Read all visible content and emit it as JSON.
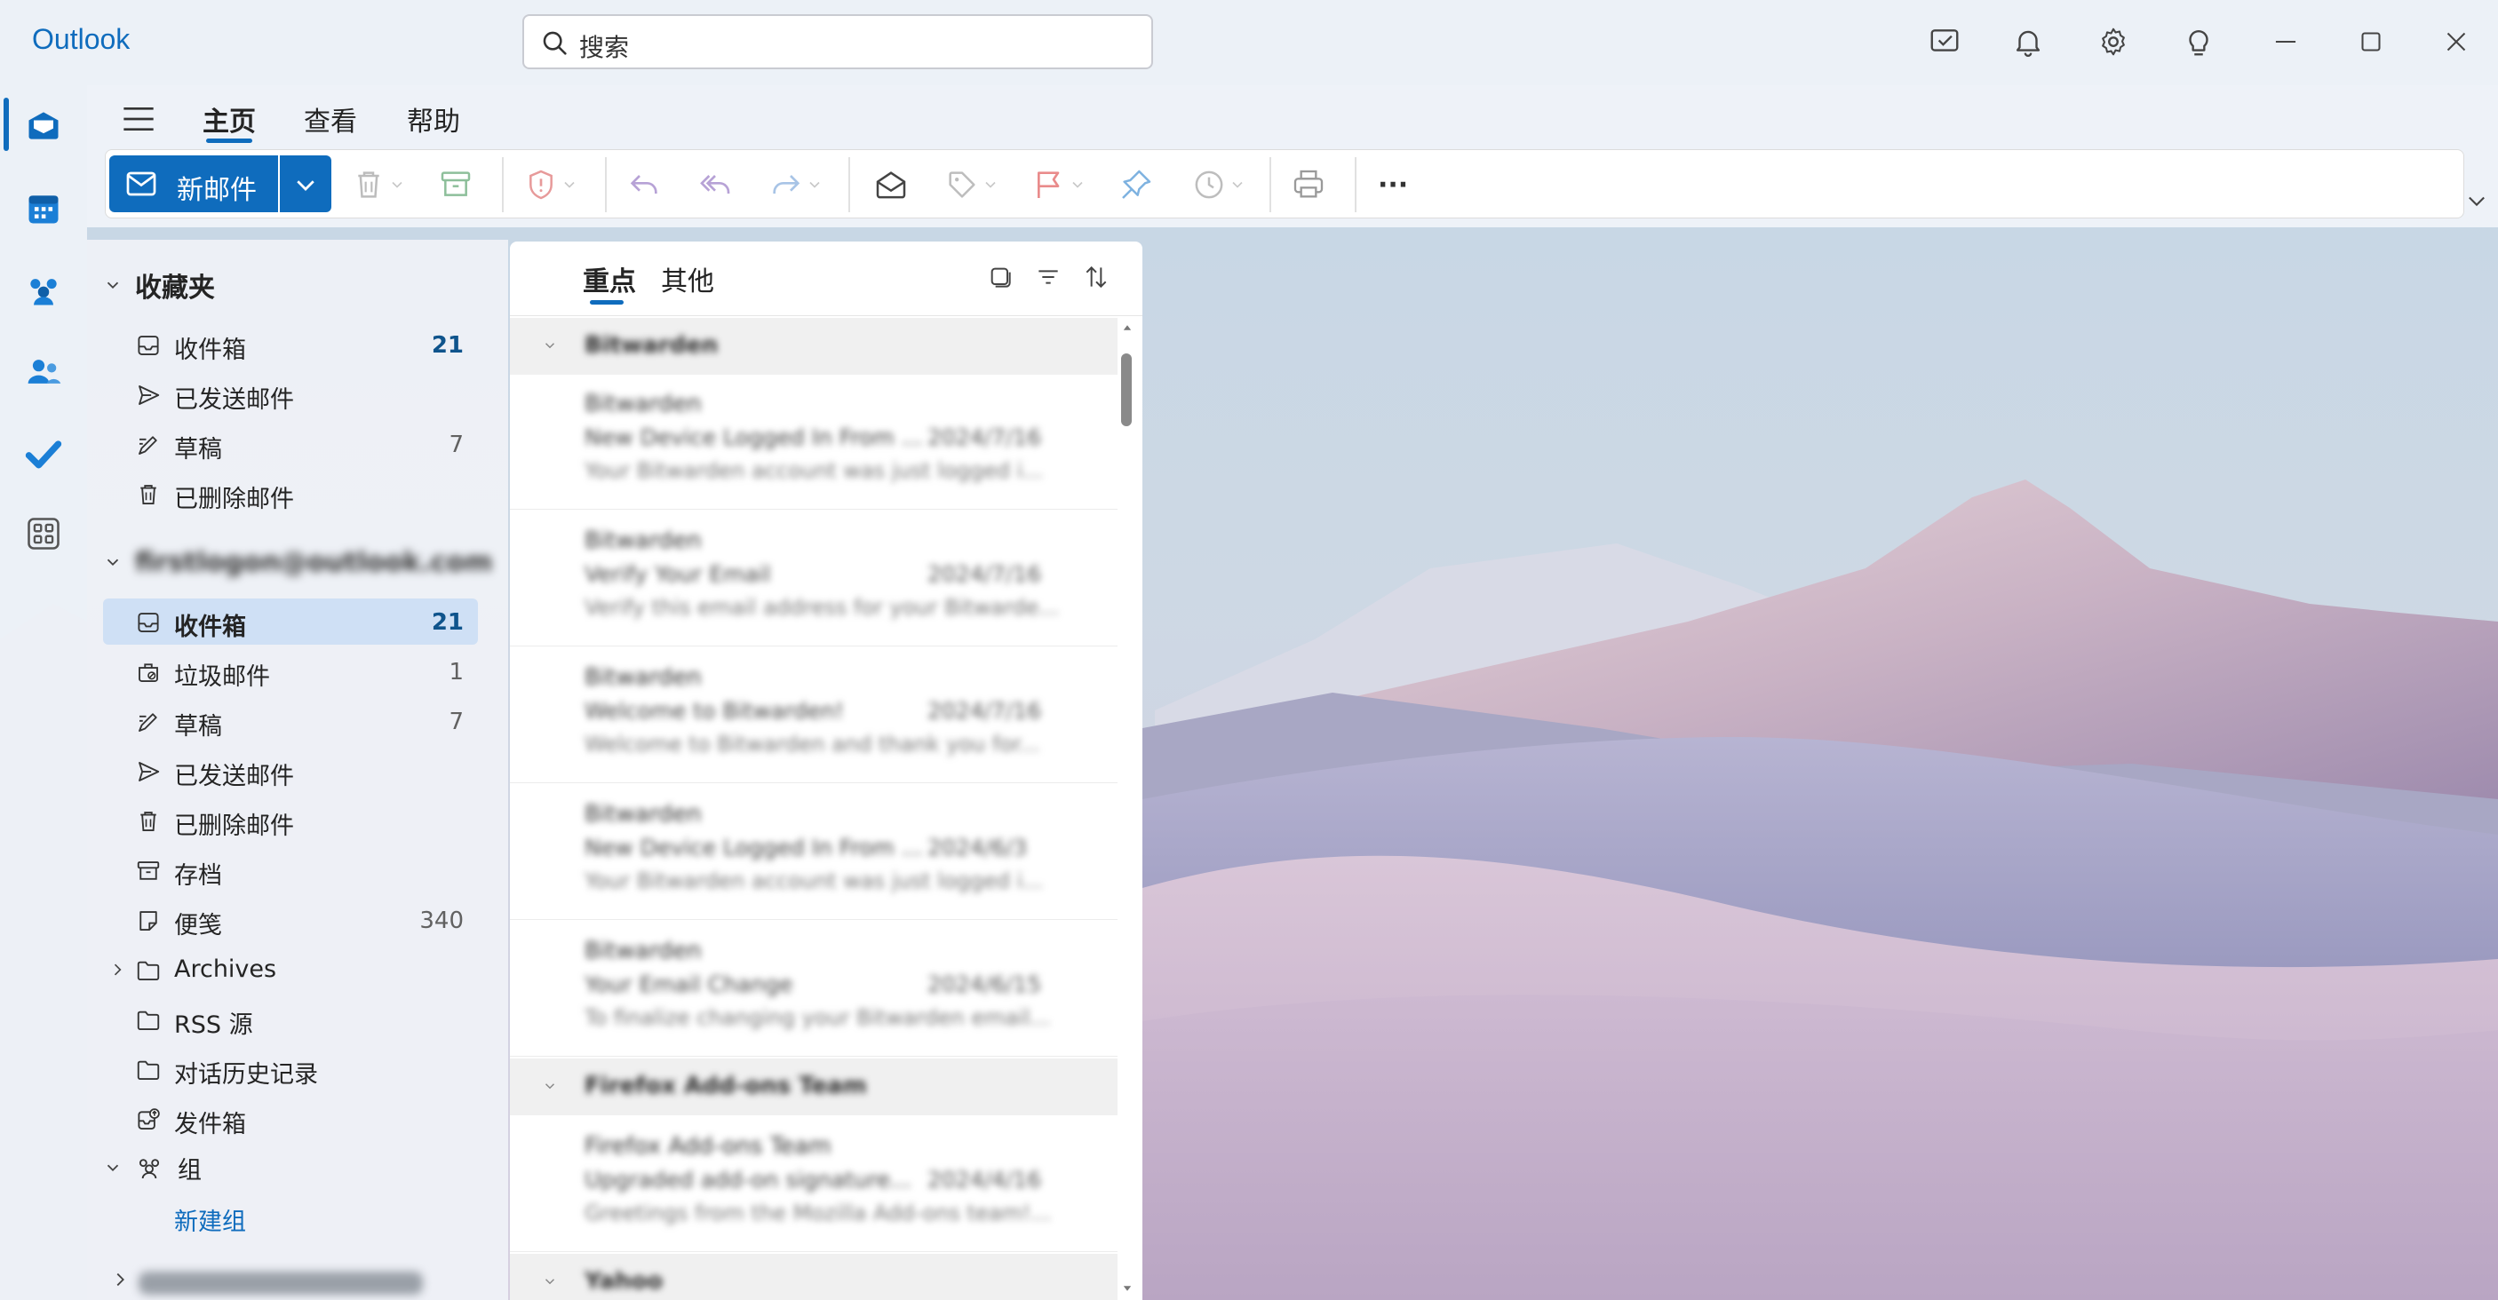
{
  "app": {
    "title": "Outlook"
  },
  "search": {
    "placeholder": "搜索"
  },
  "titlebar_icons": [
    "my-day-icon",
    "bell-icon",
    "gear-icon",
    "lightbulb-icon",
    "minimize-icon",
    "maximize-icon",
    "close-icon"
  ],
  "rail": {
    "items": [
      "mail-icon",
      "calendar-icon",
      "groups-icon",
      "people-icon",
      "todo-icon",
      "apps-icon"
    ],
    "active": "mail-icon"
  },
  "ribbon": {
    "tabs": [
      "主页",
      "查看",
      "帮助"
    ],
    "active_tab": "主页",
    "new_mail_label": "新邮件",
    "more_label": "···"
  },
  "folders": {
    "favorites_title": "收藏夹",
    "favorites": [
      {
        "label": "收件箱",
        "count": "21",
        "icon": "inbox-icon"
      },
      {
        "label": "已发送邮件",
        "count": "",
        "icon": "sent-icon"
      },
      {
        "label": "草稿",
        "count": "7",
        "icon": "drafts-icon"
      },
      {
        "label": "已删除邮件",
        "count": "",
        "icon": "trash-icon"
      }
    ],
    "account_title": "firstlogon@outlook.com",
    "account_folders": [
      {
        "label": "收件箱",
        "count": "21",
        "icon": "inbox-icon",
        "selected": true
      },
      {
        "label": "垃圾邮件",
        "count": "1",
        "icon": "junk-icon"
      },
      {
        "label": "草稿",
        "count": "7",
        "icon": "drafts-icon"
      },
      {
        "label": "已发送邮件",
        "count": "",
        "icon": "sent-icon"
      },
      {
        "label": "已删除邮件",
        "count": "",
        "icon": "trash-icon"
      },
      {
        "label": "存档",
        "count": "",
        "icon": "archive-icon"
      },
      {
        "label": "便笺",
        "count": "340",
        "icon": "note-icon"
      },
      {
        "label": "Archives",
        "count": "",
        "icon": "folder-icon",
        "expandable": true
      },
      {
        "label": "RSS 源",
        "count": "",
        "icon": "folder-icon"
      },
      {
        "label": "对话历史记录",
        "count": "",
        "icon": "folder-icon"
      },
      {
        "label": "发件箱",
        "count": "",
        "icon": "outbox-icon"
      }
    ],
    "groups_title": "组",
    "new_group_label": "新建组"
  },
  "message_list": {
    "tabs": [
      "重点",
      "其他"
    ],
    "active_tab": "重点",
    "groups": [
      {
        "header": "Bitwarden",
        "messages": [
          {
            "sender": "Bitwarden",
            "subject": "New Device Logged In From ...",
            "date": "2024/7/16",
            "preview": "Your Bitwarden account was just logged i..."
          },
          {
            "sender": "Bitwarden",
            "subject": "Verify Your Email",
            "date": "2024/7/16",
            "preview": "Verify this email address for your Bitwarde..."
          },
          {
            "sender": "Bitwarden",
            "subject": "Welcome to Bitwarden!",
            "date": "2024/7/16",
            "preview": "Welcome to Bitwarden and thank you for..."
          },
          {
            "sender": "Bitwarden",
            "subject": "New Device Logged In From ...",
            "date": "2024/6/3",
            "preview": "Your Bitwarden account was just logged i..."
          },
          {
            "sender": "Bitwarden",
            "subject": "Your Email Change",
            "date": "2024/6/15",
            "preview": "To finalize changing your Bitwarden email..."
          }
        ]
      },
      {
        "header": "Firefox Add-ons Team",
        "messages": [
          {
            "sender": "Firefox Add-ons Team",
            "subject": "Upgraded add-on signature...",
            "date": "2024/4/16",
            "preview": "Greetings from the Mozilla Add-ons team!..."
          }
        ]
      },
      {
        "header": "Yahoo",
        "messages": []
      }
    ]
  },
  "colors": {
    "accent": "#0f6cbd",
    "selected_bg": "#cfe0f5"
  }
}
